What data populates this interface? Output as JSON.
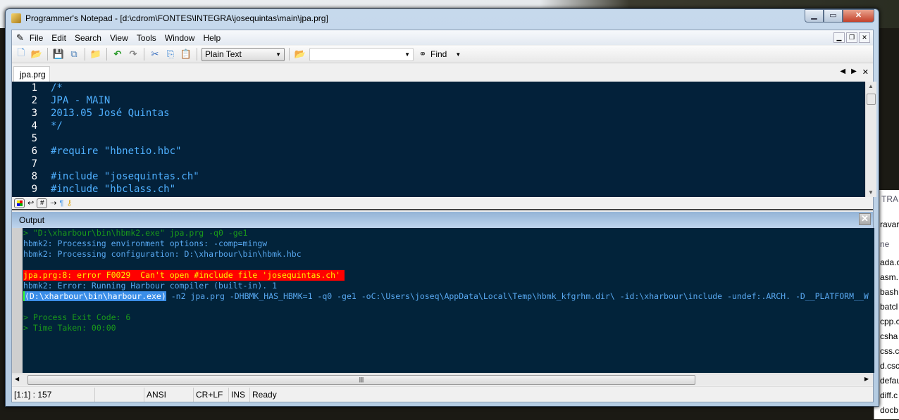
{
  "window": {
    "title": "Programmer's Notepad - [d:\\cdrom\\FONTES\\INTEGRA\\josequintas\\main\\jpa.prg]"
  },
  "menu": [
    "File",
    "Edit",
    "Search",
    "View",
    "Tools",
    "Window",
    "Help"
  ],
  "toolbar": {
    "scheme": "Plain Text",
    "search_value": "",
    "find_label": "Find"
  },
  "tabs": [
    {
      "label": "jpa.prg"
    }
  ],
  "editor": {
    "lines": [
      {
        "n": "1",
        "text": "/*"
      },
      {
        "n": "2",
        "text": "JPA - MAIN"
      },
      {
        "n": "3",
        "text": "2013.05 José Quintas"
      },
      {
        "n": "4",
        "text": "*/"
      },
      {
        "n": "5",
        "text": ""
      },
      {
        "n": "6",
        "text": "#require \"hbnetio.hbc\""
      },
      {
        "n": "7",
        "text": ""
      },
      {
        "n": "8",
        "text": "#include \"josequintas.ch\""
      },
      {
        "n": "9",
        "text": "#include \"hbclass.ch\""
      }
    ]
  },
  "output": {
    "title": "Output",
    "line1": "> \"D:\\xharbour\\bin\\hbmk2.exe\" jpa.prg -q0 -ge1",
    "line2": "hbmk2: Processing environment options: -comp=mingw",
    "line3": "hbmk2: Processing configuration: D:\\xharbour\\bin\\hbmk.hbc",
    "error": "jpa.prg:8: error F0029  Can't open #include file 'josequintas.ch'",
    "line5": "hbmk2: Error: Running Harbour compiler (built-in). 1",
    "selected": "(D:\\xharbour\\bin\\harbour.exe)",
    "line6_rest": " -n2 jpa.prg -DHBMK_HAS_HBMK=1 -q0 -ge1 -oC:\\Users\\joseq\\AppData\\Local\\Temp\\hbmk_kfgrhm.dir\\ -id:\\xharbour\\include -undef:.ARCH. -D__PLATFORM__W",
    "exit": "> Process Exit Code: 6",
    "time": "> Time Taken: 00:00"
  },
  "status": {
    "position": "[1:1] : 157",
    "encoding": "ANSI",
    "line_endings": "CR+LF",
    "mode": "INS",
    "state": "Ready"
  },
  "background_window": {
    "tab": "TRA",
    "header": "ravar",
    "column": "ne",
    "files": [
      "ada.c",
      "asm.",
      "bash",
      "batcl",
      "cpp.c",
      "csha",
      "css.c",
      "d.csc",
      "defau",
      "diff.c",
      "docb"
    ]
  }
}
